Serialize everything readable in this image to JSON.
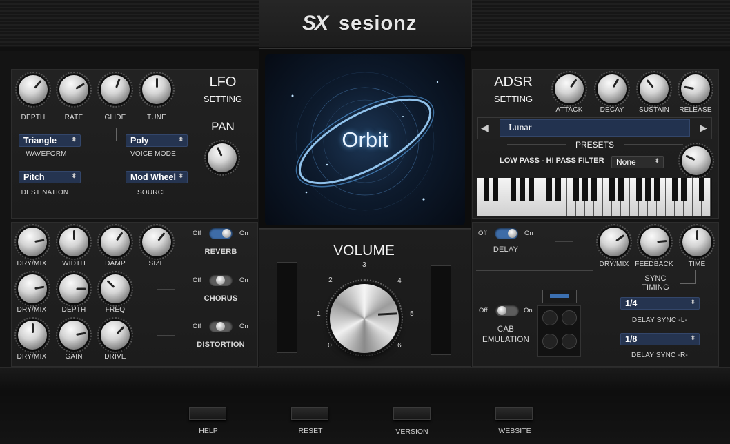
{
  "brand": {
    "logo_mark": "SX",
    "name": "sesionz"
  },
  "lfo": {
    "title": "LFO",
    "subtitle": "SETTING",
    "knobs": [
      "DEPTH",
      "RATE",
      "GLIDE",
      "TUNE"
    ],
    "waveform": {
      "value": "Triangle",
      "label": "WAVEFORM"
    },
    "voice_mode": {
      "value": "Poly",
      "label": "VOICE MODE"
    },
    "destination": {
      "value": "Pitch",
      "label": "DESTINATION"
    },
    "source": {
      "value": "Mod Wheel",
      "label": "SOURCE"
    },
    "pan_title": "PAN"
  },
  "display": {
    "preset_name": "Orbit"
  },
  "adsr": {
    "title": "ADSR",
    "subtitle": "SETTING",
    "knobs": [
      "ATTACK",
      "DECAY",
      "SUSTAIN",
      "RELEASE"
    ],
    "preset": {
      "value": "Lunar",
      "label": "PRESETS"
    },
    "filter": {
      "label": "LOW PASS - HI PASS FILTER",
      "value": "None"
    }
  },
  "effects": {
    "reverb": {
      "label": "REVERB",
      "off": "Off",
      "on": "On",
      "knobs": [
        "DRY/MIX",
        "WIDTH",
        "DAMP",
        "SIZE"
      ]
    },
    "chorus": {
      "label": "CHORUS",
      "off": "Off",
      "on": "On",
      "knobs": [
        "DRY/MIX",
        "DEPTH",
        "FREQ"
      ]
    },
    "distortion": {
      "label": "DISTORTION",
      "off": "Off",
      "on": "On",
      "knobs": [
        "DRY/MIX",
        "GAIN",
        "DRIVE"
      ]
    }
  },
  "volume": {
    "title": "VOLUME",
    "scale": [
      "0",
      "1",
      "2",
      "3",
      "4",
      "5",
      "6"
    ]
  },
  "delay": {
    "label": "DELAY",
    "off": "Off",
    "on": "On",
    "knobs": [
      "DRY/MIX",
      "FEEDBACK",
      "TIME"
    ],
    "sync_title_1": "SYNC",
    "sync_title_2": "TIMING",
    "sync_l": {
      "value": "1/4",
      "label": "DELAY SYNC -L-"
    },
    "sync_r": {
      "value": "1/8",
      "label": "DELAY SYNC -R-"
    }
  },
  "cab": {
    "label_1": "CAB",
    "label_2": "EMULATION",
    "off": "Off",
    "on": "On"
  },
  "footer": {
    "help": "HELP",
    "reset": "RESET",
    "version": "VERSION",
    "website": "WEBSITE"
  },
  "colors": {
    "accent": "#3e6ca7",
    "select_bg": "#253450",
    "display_glow": "#6ab8ff"
  },
  "icons": {
    "prev": "left-triangle",
    "next": "right-triangle"
  }
}
